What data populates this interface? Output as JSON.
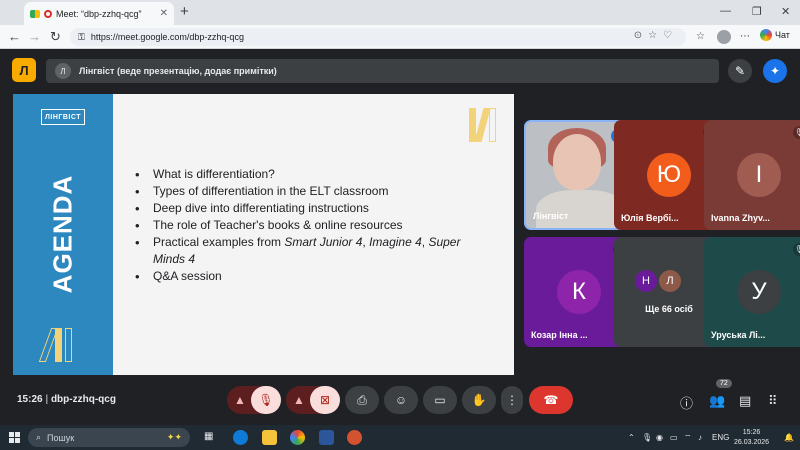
{
  "browser": {
    "tab_title": "Meet: “dbp-zzhq-qcg”",
    "tab_close": "✕",
    "new_tab": "+",
    "url": "https://meet.google.com/dbp-zzhq-qcg",
    "chat_label": "Чат",
    "icons": [
      "back-icon",
      "forward-icon",
      "reload-icon",
      "lock-icon",
      "star-icon",
      "extensions-icon",
      "more-icon",
      "copilot-icon"
    ]
  },
  "meet": {
    "brand_letter": "Л",
    "presenter_initial": "Л",
    "presenter_text": "Лінгвіст (веде презентацію, додає примітки)",
    "slide": {
      "logo_text": "ЛІНГВІСТ",
      "side_title": "AGENDA",
      "bullets": [
        {
          "text": "What is differentiation?"
        },
        {
          "text": "Types of differentiation in the ELT classroom"
        },
        {
          "text": "Deep dive into differentiating instructions"
        },
        {
          "text": "The role of Teacher's books & online resources"
        },
        {
          "pre": "Practical examples from ",
          "i1": "Smart Junior 4",
          "mid1": ", ",
          "i2": "Imagine 4",
          "mid2": ", ",
          "i3": "Super Minds 4"
        },
        {
          "text": "Q&A session"
        }
      ]
    },
    "tiles": [
      {
        "name": "Лінгвіст",
        "type": "video"
      },
      {
        "name": "Юлія Вербі...",
        "initial": "Ю",
        "bg": "#7e2a22",
        "avatar_color": "#f25d1c"
      },
      {
        "name": "Ivanna Zhyv...",
        "initial": "I",
        "bg": "#7a3a35",
        "avatar_color": "#a05c50"
      },
      {
        "name": "Козар Інна ...",
        "initial": "К",
        "bg": "#6a1b9a",
        "avatar_color": "#8e24aa"
      },
      {
        "name": "Ще 66 осіб",
        "initials": [
          "Н",
          "Л"
        ]
      },
      {
        "name": "Уруська Лі...",
        "initial": "У",
        "bg": "#1e4a4a",
        "avatar_color": "#3c4043"
      }
    ],
    "controls": {
      "time": "15:26",
      "separator": "|",
      "meeting_code": "dbp-zzhq-qcg",
      "participants_count": "72"
    }
  },
  "taskbar": {
    "search_placeholder": "Пошук",
    "lang": "ENG",
    "time": "15:26",
    "date": "26.03.2026"
  },
  "colors": {
    "meet_bg": "#202124",
    "slide_accent": "#2e88c0",
    "end_call": "#dc362e",
    "muted_bg": "#f9dedc"
  }
}
